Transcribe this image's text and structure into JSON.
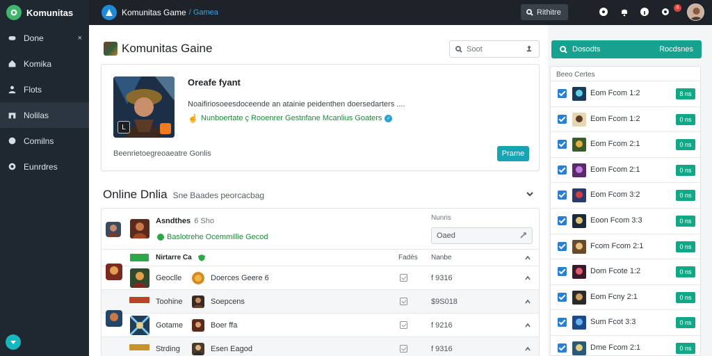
{
  "sidebar": {
    "brand": "Komunitas",
    "items": [
      {
        "label": "Done",
        "icon": "game-icon",
        "close": "×"
      },
      {
        "label": "Komika",
        "icon": "home-icon"
      },
      {
        "label": "Flots",
        "icon": "user-icon"
      },
      {
        "label": "Nolilas",
        "icon": "store-icon"
      },
      {
        "label": "Comilns",
        "icon": "chat-icon"
      },
      {
        "label": "Eunrdres",
        "icon": "settings-icon"
      }
    ],
    "active_index": 3
  },
  "topbar": {
    "title": "Komunitas Game",
    "subtitle": "/ Gamea",
    "search_label": "Rithitre",
    "notification_count": "6"
  },
  "main": {
    "title": "Komunitas Gaine",
    "search_placeholder": "Soot",
    "hero": {
      "title": "Oreafe fyant",
      "description": "Noaifiriosoeesdoceende an atainie peidenthen doersedarters ....",
      "tags": "Nunboertate ç Rooenrer Gestnfane Mcanlius Goaters",
      "footer": "Beenrietoegreoaeatre Gonlis",
      "button": "Prame",
      "corner_label": "L"
    },
    "section": {
      "title": "Online Dnlia",
      "subtitle": "Sne Baades peorcacbag"
    },
    "seller": {
      "name": "Asndthes",
      "rating": "6 Sho",
      "tag": "Baslotrehe Ocemmillie Gecod"
    },
    "price": {
      "label": "Nunris",
      "value": "Oaed"
    },
    "table": {
      "headers": [
        "Nirtarre Ca",
        "Fadés",
        "Nanbe"
      ],
      "rows": [
        {
          "name": "Geoclle",
          "service": "Doerces Geere 6",
          "amount": "f 9316"
        },
        {
          "name": "Toohine",
          "service": "Soepcens",
          "amount": "$9S018"
        },
        {
          "name": "Gotame",
          "service": "Boer ffa",
          "amount": "f 9216"
        },
        {
          "name": "Strding",
          "service": "Esen Eagod",
          "amount": "f 9316"
        }
      ]
    }
  },
  "right": {
    "cta_left": "Dosodts",
    "cta_right": "Rocdsnes",
    "panel_title": "Beeo Certes",
    "items": [
      {
        "label": "Eom Fcom 1:2",
        "value": "8 ns"
      },
      {
        "label": "Eom Fcom 1:2",
        "value": "0 ns"
      },
      {
        "label": "Eom Fcom 2:1",
        "value": "0 ns"
      },
      {
        "label": "Eom Fcom 2:1",
        "value": "0 ns"
      },
      {
        "label": "Eom Fcom 3:2",
        "value": "0 ns"
      },
      {
        "label": "Eoon Fcom 3:3",
        "value": "0 ns"
      },
      {
        "label": "Fcom Fcom 2:1",
        "value": "0 ns"
      },
      {
        "label": "Dom Fcote 1:2",
        "value": "0 ns"
      },
      {
        "label": "Eom Fcny 2:1",
        "value": "0 ns"
      },
      {
        "label": "Sum Fcot 3:3",
        "value": "0 ns"
      },
      {
        "label": "Dme Fcom 2:1",
        "value": "0 ns"
      }
    ]
  },
  "colors": {
    "sidebar_bg": "#1f2730",
    "topbar_bg": "#1d2329",
    "accent_teal": "#16a28f",
    "button_teal": "#17a3b2",
    "check_blue": "#2b7fd1",
    "tag_green": "#1a8a3a"
  }
}
